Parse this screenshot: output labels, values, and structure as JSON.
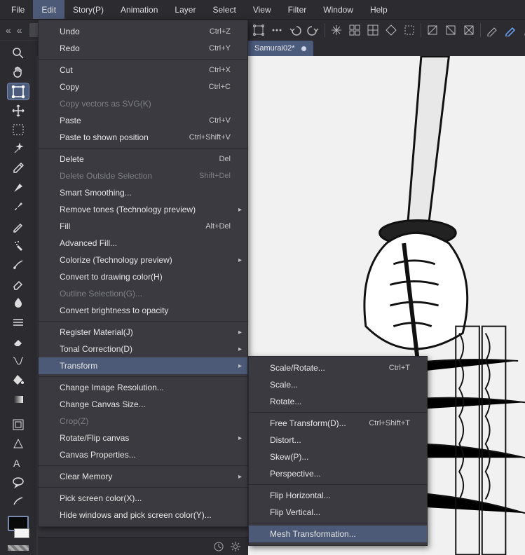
{
  "menubar": {
    "items": [
      {
        "label": "File"
      },
      {
        "label": "Edit",
        "active": true
      },
      {
        "label": "Story(P)"
      },
      {
        "label": "Animation"
      },
      {
        "label": "Layer"
      },
      {
        "label": "Select"
      },
      {
        "label": "View"
      },
      {
        "label": "Filter"
      },
      {
        "label": "Window"
      },
      {
        "label": "Help"
      }
    ]
  },
  "tabs": {
    "active": {
      "label": "Samurai02*"
    }
  },
  "edit_menu": {
    "undo": {
      "label": "Undo",
      "accel": "Ctrl+Z"
    },
    "redo": {
      "label": "Redo",
      "accel": "Ctrl+Y"
    },
    "cut": {
      "label": "Cut",
      "accel": "Ctrl+X"
    },
    "copy": {
      "label": "Copy",
      "accel": "Ctrl+C"
    },
    "copy_svg": {
      "label": "Copy vectors as SVG(K)"
    },
    "paste": {
      "label": "Paste",
      "accel": "Ctrl+V"
    },
    "paste_pos": {
      "label": "Paste to shown position",
      "accel": "Ctrl+Shift+V"
    },
    "delete": {
      "label": "Delete",
      "accel": "Del"
    },
    "del_outside": {
      "label": "Delete Outside Selection",
      "accel": "Shift+Del"
    },
    "smart_smooth": {
      "label": "Smart Smoothing..."
    },
    "remove_tones": {
      "label": "Remove tones (Technology preview)"
    },
    "fill": {
      "label": "Fill",
      "accel": "Alt+Del"
    },
    "adv_fill": {
      "label": "Advanced Fill..."
    },
    "colorize": {
      "label": "Colorize (Technology preview)"
    },
    "to_drawing": {
      "label": "Convert to drawing color(H)"
    },
    "outline_sel": {
      "label": "Outline Selection(G)..."
    },
    "bright_opac": {
      "label": "Convert brightness to opacity"
    },
    "reg_material": {
      "label": "Register Material(J)"
    },
    "tonal": {
      "label": "Tonal Correction(D)"
    },
    "transform": {
      "label": "Transform"
    },
    "img_res": {
      "label": "Change Image Resolution..."
    },
    "canvas_size": {
      "label": "Change Canvas Size..."
    },
    "crop": {
      "label": "Crop(Z)"
    },
    "rotate_flip": {
      "label": "Rotate/Flip canvas"
    },
    "canvas_props": {
      "label": "Canvas Properties..."
    },
    "clear_mem": {
      "label": "Clear Memory"
    },
    "pick_color": {
      "label": "Pick screen color(X)..."
    },
    "hide_pick": {
      "label": "Hide windows and pick screen color(Y)..."
    }
  },
  "transform_menu": {
    "scale_rotate": {
      "label": "Scale/Rotate...",
      "accel": "Ctrl+T"
    },
    "scale": {
      "label": "Scale..."
    },
    "rotate": {
      "label": "Rotate..."
    },
    "free": {
      "label": "Free Transform(D)...",
      "accel": "Ctrl+Shift+T"
    },
    "distort": {
      "label": "Distort..."
    },
    "skew": {
      "label": "Skew(P)..."
    },
    "perspective": {
      "label": "Perspective..."
    },
    "flip_h": {
      "label": "Flip Horizontal..."
    },
    "flip_v": {
      "label": "Flip Vertical..."
    },
    "mesh": {
      "label": "Mesh Transformation..."
    }
  },
  "toolbar_icons": [
    "handles-icon",
    "three-dots-icon",
    "undo-icon",
    "redo-icon",
    "sep",
    "sparkle-icon",
    "grid-a-icon",
    "grid-b-icon",
    "diamond-icon",
    "dashed-icon",
    "sep",
    "diag-a-icon",
    "diag-b-icon",
    "diag-c-icon",
    "sep",
    "pen-a-icon",
    "pen-b-icon",
    "pen-c-icon",
    "pen-d-icon"
  ],
  "left_tools": [
    "magnifier-icon",
    "hand-icon",
    "move-icon",
    "transform-handles-icon",
    "marquee-icon",
    "magic-wand-icon",
    "eyedropper-icon",
    "pen-icon",
    "brush-icon",
    "pencil-icon",
    "dot-brush-icon",
    "eraser-soft-icon",
    "palette-knife-icon",
    "lines-icon",
    "eraser-icon",
    "warp-icon",
    "bucket-icon",
    "square-icon",
    "sep",
    "frame-icon",
    "vector-shape-icon",
    "text-icon",
    "balloon-icon",
    "effect-brush-icon"
  ]
}
